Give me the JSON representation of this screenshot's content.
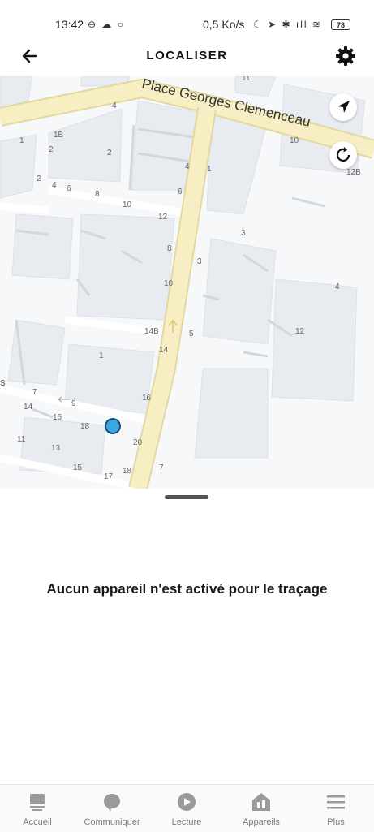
{
  "status_bar": {
    "time": "13:42",
    "left_icons": "⊖ ☁ ○",
    "speed": "0,5 Ko/s",
    "right_icons": "☾ ➤ ✱ ıll ≋",
    "battery": "78"
  },
  "header": {
    "title": "LOCALISER",
    "back_icon": "back-arrow-icon",
    "settings_icon": "gear-icon"
  },
  "map": {
    "street_name": "Place Georges Clemenceau",
    "house_numbers": [
      "11",
      "4",
      "1B",
      "2",
      "2",
      "4",
      "1",
      "6",
      "2",
      "8",
      "4",
      "6",
      "10",
      "12",
      "1",
      "10",
      "12B",
      "8",
      "3",
      "3",
      "10",
      "4",
      "14B",
      "5",
      "12",
      "14",
      "1",
      "7",
      "9",
      "16",
      "14",
      "16",
      "18",
      "20",
      "11",
      "13",
      "15",
      "17",
      "18",
      "7",
      "s"
    ],
    "location_button_icon": "navigation-arrow-icon",
    "refresh_button_icon": "refresh-icon",
    "marker_color": "#3aa8e0"
  },
  "empty_state": {
    "message": "Aucun appareil n'est activé pour le traçage"
  },
  "bottom_nav": {
    "items": [
      {
        "label": "Accueil",
        "icon": "home-icon"
      },
      {
        "label": "Communiquer",
        "icon": "chat-bubble-icon"
      },
      {
        "label": "Lecture",
        "icon": "play-icon"
      },
      {
        "label": "Appareils",
        "icon": "devices-house-icon"
      },
      {
        "label": "Plus",
        "icon": "menu-icon"
      }
    ]
  },
  "colors": {
    "road": "#f7efc3",
    "road_edge": "#e6dca6",
    "building": "#e6e9ee",
    "nav_icon": "#9a9a9a",
    "marker": "#3aa8e0"
  }
}
